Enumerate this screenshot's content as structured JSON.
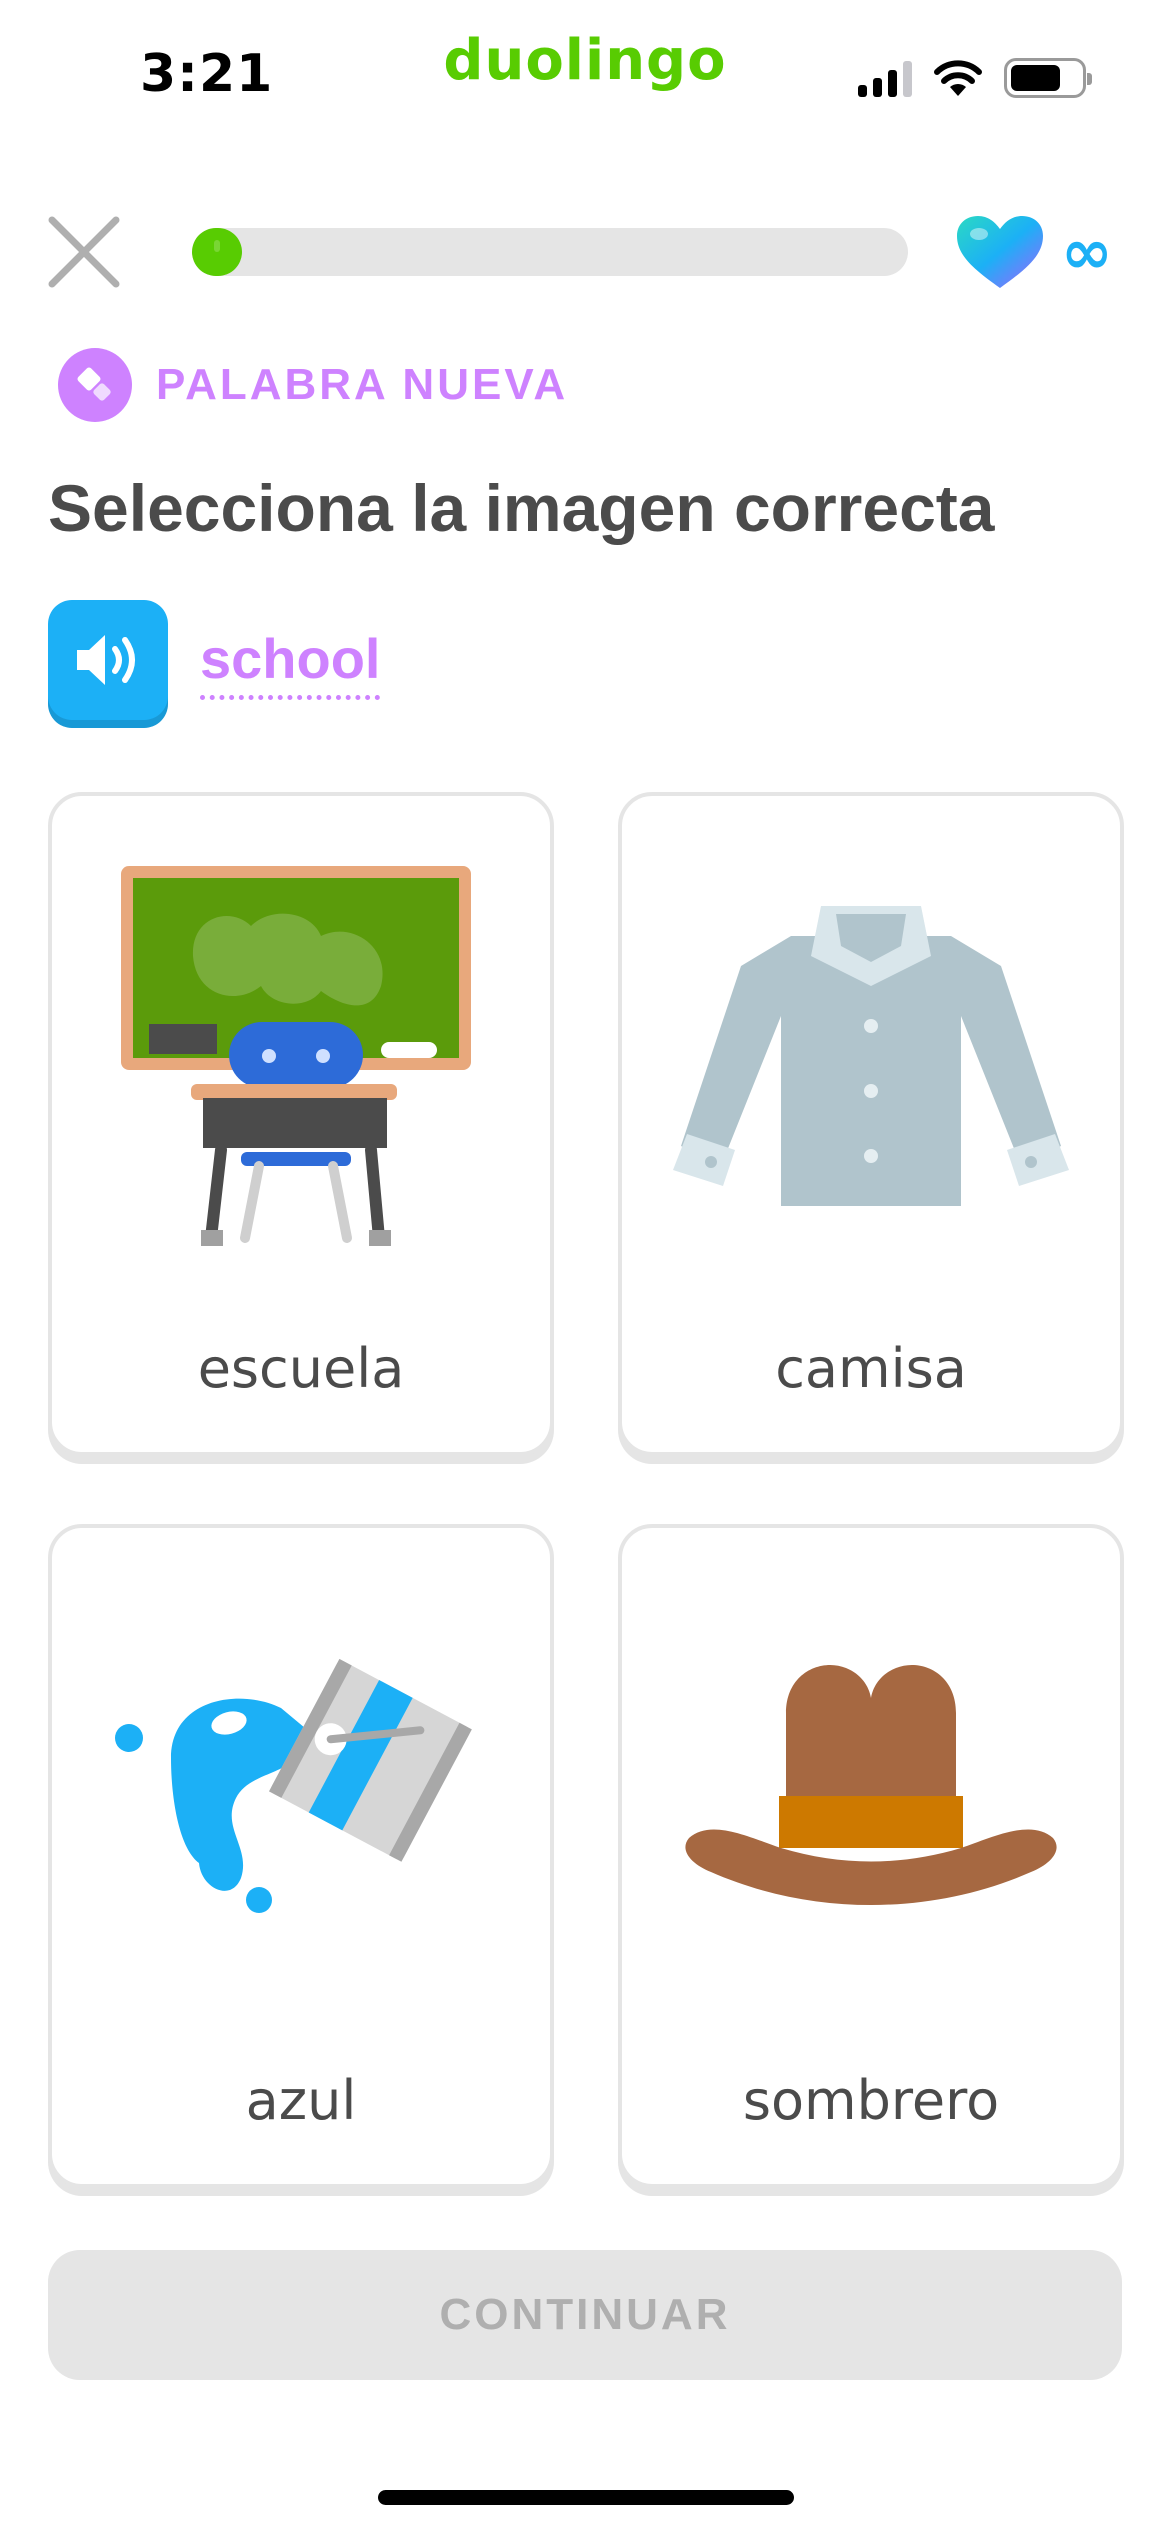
{
  "status_bar": {
    "time": "3:21",
    "app_brand": "duolingo",
    "icons": [
      "signal-icon",
      "wifi-icon",
      "battery-icon"
    ]
  },
  "lesson": {
    "progress_percent": 7,
    "hearts": "infinity",
    "badge_label": "PALABRA NUEVA",
    "title": "Selecciona la imagen correcta",
    "prompt_word": "school"
  },
  "choices": [
    {
      "word": "escuela",
      "icon": "school-desk-chalkboard-icon"
    },
    {
      "word": "camisa",
      "icon": "shirt-icon"
    },
    {
      "word": "azul",
      "icon": "blue-paint-bucket-icon"
    },
    {
      "word": "sombrero",
      "icon": "hat-icon"
    }
  ],
  "continue_label": "CONTINUAR",
  "colors": {
    "brand_green": "#58cc02",
    "accent_purple": "#ce82ff",
    "accent_blue": "#1cb0f6",
    "disabled_gray": "#e5e5e5",
    "text": "#4b4b4b"
  }
}
